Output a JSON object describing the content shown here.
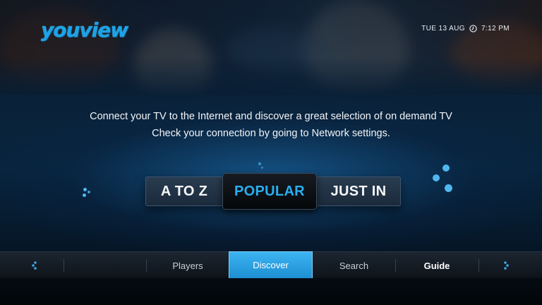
{
  "header": {
    "logo_text": "youview",
    "date": "TUE 13 AUG",
    "time": "7:12 PM",
    "clock_icon": "clock-icon"
  },
  "message": {
    "line1": "Connect your TV to the Internet and discover a great selection of on demand TV",
    "line2": "Check your connection by going to Network settings."
  },
  "tabs": {
    "items": [
      {
        "label": "A TO Z"
      },
      {
        "label": "POPULAR",
        "selected": true
      },
      {
        "label": "JUST IN"
      }
    ]
  },
  "navbar": {
    "items": [
      {
        "label": "Players"
      },
      {
        "label": "Discover",
        "selected": true
      },
      {
        "label": "Search"
      },
      {
        "label": "Guide"
      }
    ],
    "left_icon": "dots-left-icon",
    "right_icon": "dots-right-icon"
  },
  "colors": {
    "accent": "#29aef0",
    "highlight": "#2fa3e6",
    "background": "#08243d"
  }
}
